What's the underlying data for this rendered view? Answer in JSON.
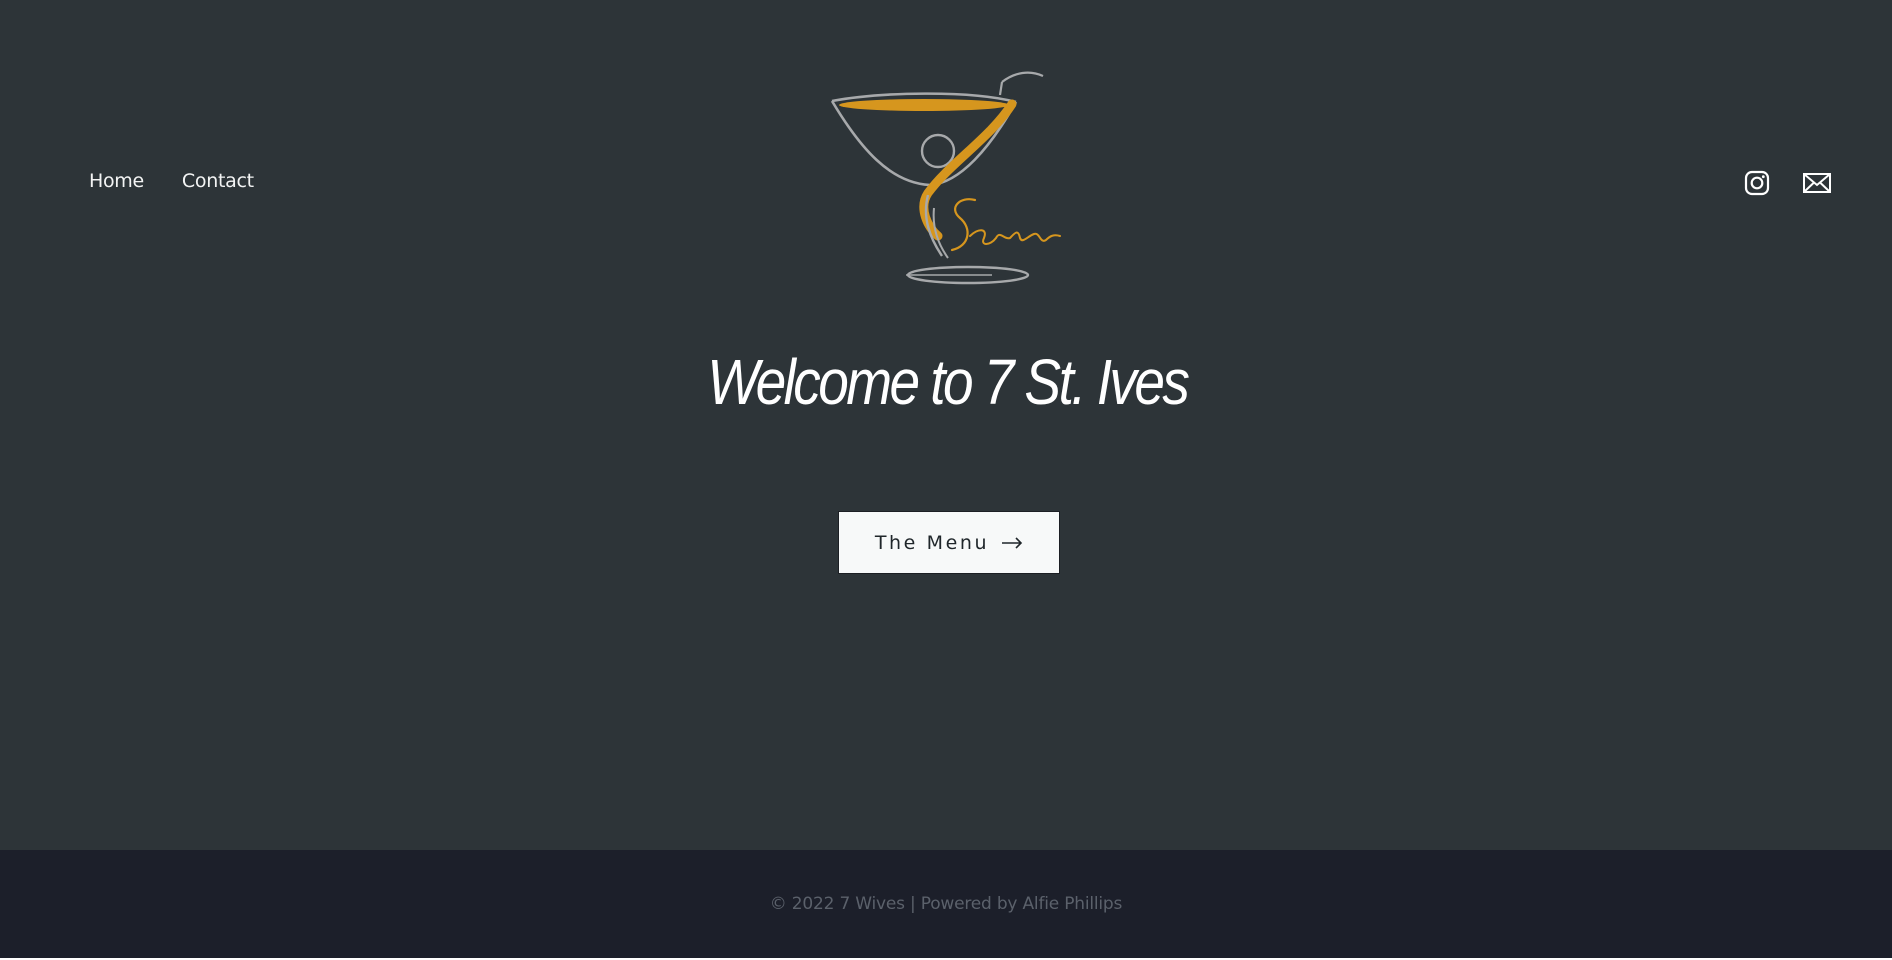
{
  "nav": {
    "items": [
      {
        "label": "Home"
      },
      {
        "label": "Contact"
      }
    ]
  },
  "logo": {
    "text": "Seven",
    "icon": "martini-glass-logo",
    "colors": {
      "liquid": "#d6961e",
      "glass": "#a7a9ab",
      "script": "#d6961e"
    }
  },
  "social": {
    "icons": [
      "instagram-icon",
      "mail-icon"
    ]
  },
  "hero": {
    "title": "Welcome to 7 St. Ives",
    "cta_label": "The Menu",
    "cta_icon": "arrow-right-icon"
  },
  "footer": {
    "copyright": "© 2022 7 Wives | Powered by Alfie Phillips"
  },
  "colors": {
    "hero_bg": "#2d3438",
    "footer_bg": "#1c1f2a",
    "accent": "#d6961e",
    "button_bg": "#f7f9f9"
  }
}
